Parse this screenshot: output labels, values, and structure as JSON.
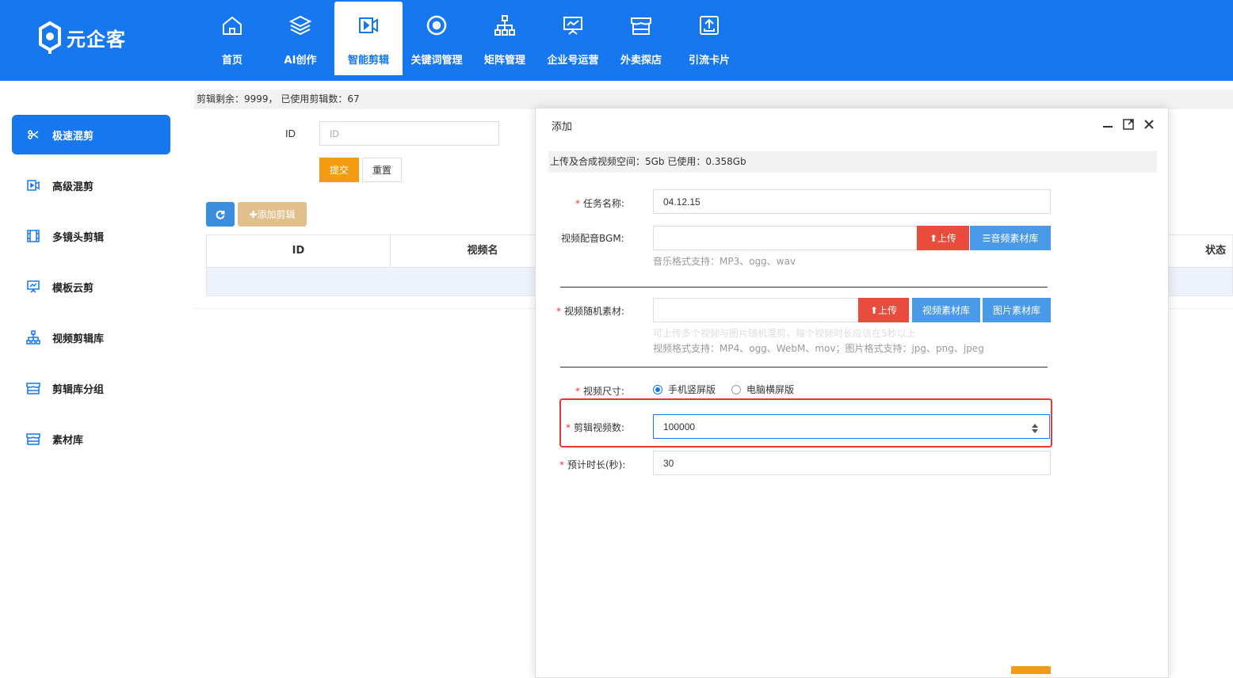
{
  "app": {
    "logo_text": "元企客"
  },
  "nav": [
    {
      "label": "首页",
      "icon": "home-icon"
    },
    {
      "label": "AI创作",
      "icon": "layers-icon"
    },
    {
      "label": "智能剪辑",
      "icon": "video-edit-icon",
      "active": true
    },
    {
      "label": "关键词管理",
      "icon": "target-icon"
    },
    {
      "label": "矩阵管理",
      "icon": "hierarchy-icon"
    },
    {
      "label": "企业号运营",
      "icon": "presentation-icon"
    },
    {
      "label": "外卖探店",
      "icon": "store-icon"
    },
    {
      "label": "引流卡片",
      "icon": "share-card-icon"
    }
  ],
  "sidebar": [
    {
      "label": "极速混剪",
      "icon": "scissors-icon",
      "active": true
    },
    {
      "label": "高级混剪",
      "icon": "video-edit-icon"
    },
    {
      "label": "多镜头剪辑",
      "icon": "film-icon"
    },
    {
      "label": "模板云剪",
      "icon": "presentation-icon"
    },
    {
      "label": "视频剪辑库",
      "icon": "hierarchy-icon"
    },
    {
      "label": "剪辑库分组",
      "icon": "store-icon"
    },
    {
      "label": "素材库",
      "icon": "store-icon"
    }
  ],
  "main": {
    "quota_text": "剪辑剩余：9999， 已使用剪辑数：67",
    "id_label": "ID",
    "id_placeholder": "ID",
    "submit_label": "提交",
    "reset_label": "重置",
    "add_clip_label": "添加剪辑",
    "table_headers": [
      "ID",
      "视频名",
      "状态"
    ]
  },
  "modal": {
    "title": "添加",
    "space_text": "上传及合成视频空间：5Gb 已使用：0.358Gb",
    "task_name_label": "任务名称:",
    "task_name_value": "04.12.15",
    "bgm_label": "视频配音BGM:",
    "bgm_value": "",
    "upload_label": "上传",
    "audio_lib_label": "音频素材库",
    "bgm_hint": "音乐格式支持：MP3、ogg、wav",
    "material_label": "视频随机素材:",
    "material_value": "",
    "video_lib_label": "视频素材库",
    "image_lib_label": "图片素材库",
    "material_hint_faint": "可上传多个视频与图片随机混剪，每个视频时长应该在5秒以上",
    "material_hint": "视频格式支持：MP4、ogg、WebM、mov；图片格式支持：jpg、png、jpeg",
    "size_label": "视频尺寸:",
    "size_options": [
      "手机竖屏版",
      "电脑横屏版"
    ],
    "size_selected": "手机竖屏版",
    "count_label": "剪辑视频数:",
    "count_value": "100000",
    "duration_label": "预计时长(秒):",
    "duration_value": "30"
  },
  "colors": {
    "primary": "#1677ee",
    "warning": "#f39c12",
    "danger": "#e74c3c",
    "info": "#4a9ae8"
  }
}
